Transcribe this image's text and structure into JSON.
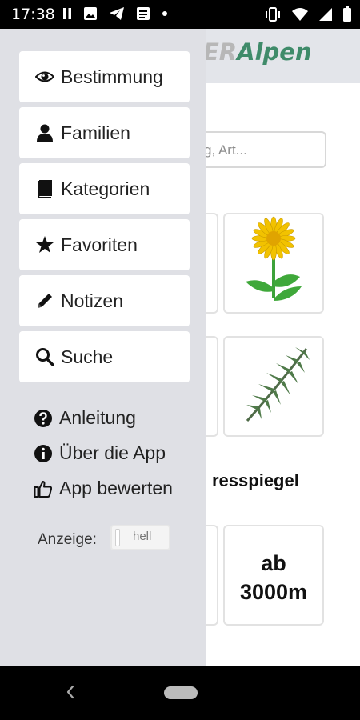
{
  "status_bar": {
    "time": "17:38",
    "left_icons": [
      "pause-icon",
      "image-icon",
      "telegram-icon",
      "news-icon",
      "dot-icon"
    ],
    "right_icons": [
      "vibrate-icon",
      "wifi-icon",
      "signal-icon",
      "battery-icon"
    ]
  },
  "background_app": {
    "logo_part1": "ER",
    "logo_part2": "Alpen",
    "search_placeholder": "g, Art...",
    "section_title": "resspiegel",
    "tile_text_line1": "ab",
    "tile_text_line2": "3000m",
    "accent_color": "#3f8b6a"
  },
  "drawer": {
    "menu": [
      {
        "label": "Bestimmung",
        "icon": "eye-icon"
      },
      {
        "label": "Familien",
        "icon": "person-icon"
      },
      {
        "label": "Kategorien",
        "icon": "book-icon"
      },
      {
        "label": "Favoriten",
        "icon": "star-icon"
      },
      {
        "label": "Notizen",
        "icon": "pencil-icon"
      },
      {
        "label": "Suche",
        "icon": "search-icon"
      }
    ],
    "links": [
      {
        "label": "Anleitung",
        "icon": "help-circle-icon"
      },
      {
        "label": "Über die App",
        "icon": "info-circle-icon"
      },
      {
        "label": "App bewerten",
        "icon": "thumbs-up-icon"
      }
    ],
    "display_label": "Anzeige:",
    "display_toggle_value": "hell"
  },
  "nav_bar": {
    "icons": [
      "back-icon",
      "home-pill-icon"
    ]
  }
}
